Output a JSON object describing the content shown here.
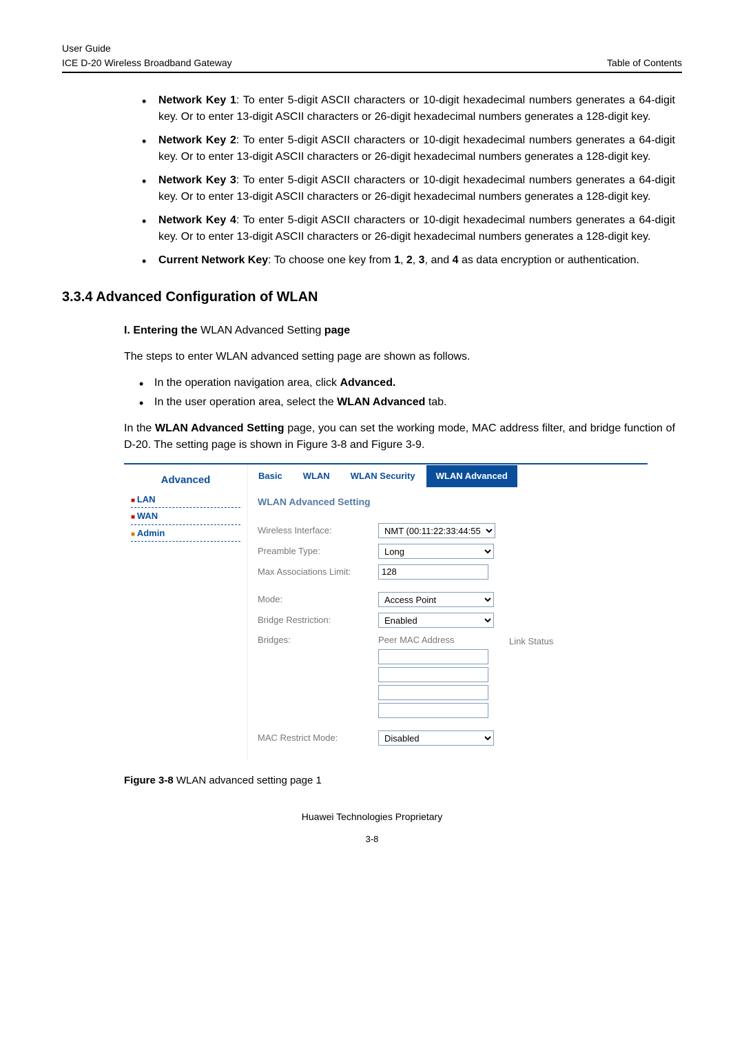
{
  "header": {
    "left_line1": "User Guide",
    "left_line2": "ICE D-20 Wireless Broadband Gateway",
    "right": "Table of Contents"
  },
  "bullets": [
    {
      "label": "Network Key 1",
      "rest": ": To enter 5-digit ASCII characters or 10-digit hexadecimal numbers generates a 64-digit key. Or to enter 13-digit ASCII characters or 26-digit hexadecimal numbers generates a 128-digit key."
    },
    {
      "label": "Network Key 2",
      "rest": ": To enter 5-digit ASCII characters or 10-digit hexadecimal numbers generates a 64-digit key. Or to enter 13-digit ASCII characters or 26-digit hexadecimal numbers generates a 128-digit key."
    },
    {
      "label": "Network Key 3",
      "rest": ": To enter 5-digit ASCII characters or 10-digit hexadecimal numbers generates a 64-digit key. Or to enter 13-digit ASCII characters or 26-digit hexadecimal numbers generates a 128-digit key."
    },
    {
      "label": "Network Key 4",
      "rest": ": To enter 5-digit ASCII characters or 10-digit hexadecimal numbers generates a 64-digit key. Or to enter 13-digit ASCII characters or 26-digit hexadecimal numbers generates a 128-digit key."
    },
    {
      "label": "Current Network Key",
      "rest": ": To choose one key from ",
      "b1": "1",
      "c1": ", ",
      "b2": "2",
      "c2": ", ",
      "b3": "3",
      "c3": ", and ",
      "b4": "4",
      "c4": " as data encryption or authentication."
    }
  ],
  "section_title": "3.3.4  Advanced Configuration of WLAN",
  "sub_heading_prefix": "I. Entering the ",
  "sub_heading_mid": "WLAN Advanced Setting",
  "sub_heading_suffix": " page",
  "steps_intro": "The steps to enter WLAN advanced setting page are shown as follows.",
  "steps": [
    {
      "pre": "In the operation navigation area, click ",
      "bold": "Advanced."
    },
    {
      "pre": "In the user operation area, select the ",
      "bold": "WLAN Advanced",
      "post": " tab."
    }
  ],
  "para2_pre": "In the ",
  "para2_b1": "WLAN Advanced Setting",
  "para2_mid": " page, you can set the working mode, MAC address filter, and bridge function of D-20. The setting page is shown in Figure 3-8 and Figure 3-9.",
  "figure": {
    "nav": {
      "title": "Advanced",
      "items": [
        "LAN",
        "WAN",
        "Admin"
      ]
    },
    "tabs": [
      "Basic",
      "WLAN",
      "WLAN Security",
      "WLAN Advanced"
    ],
    "panel_title": "WLAN Advanced Setting",
    "rows": {
      "wireless_interface_label": "Wireless Interface:",
      "wireless_interface_value": "NMT (00:11:22:33:44:55",
      "preamble_label": "Preamble Type:",
      "preamble_value": "Long",
      "max_assoc_label": "Max Associations Limit:",
      "max_assoc_value": "128",
      "mode_label": "Mode:",
      "mode_value": "Access Point",
      "bridge_restriction_label": "Bridge Restriction:",
      "bridge_restriction_value": "Enabled",
      "bridges_label": "Bridges:",
      "peer_mac_label": "Peer MAC Address",
      "link_status_label": "Link Status",
      "mac_restrict_label": "MAC Restrict Mode:",
      "mac_restrict_value": "Disabled"
    }
  },
  "caption_bold": "Figure 3-8 ",
  "caption_rest": "WLAN advanced setting page 1",
  "footer1": "Huawei Technologies Proprietary",
  "footer2": "3-8"
}
